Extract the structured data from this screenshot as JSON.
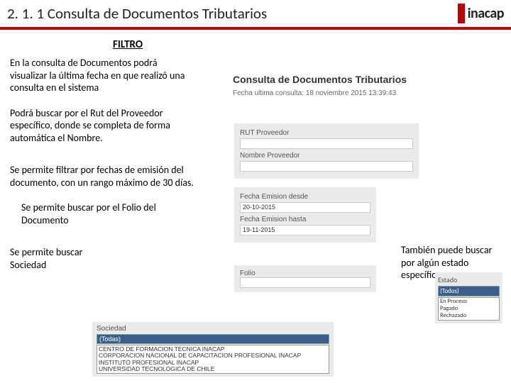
{
  "header": {
    "title": "2. 1. 1 Consulta de Documentos Tributarios",
    "logo": "inacap"
  },
  "filtro_heading": "FILTRO",
  "paras": {
    "p1": "En la consulta de Documentos podrá visualizar la última fecha en que realizó una consulta  en el sistema",
    "p2": "Podrá buscar por el Rut del Proveedor específico, donde se completa de forma automática el Nombre.",
    "p3": "Se permite filtrar por fechas de emisión del documento, con un rango máximo de 30 días.",
    "p4": "Se permite buscar por el Folio del Documento",
    "p5": "Se permite buscar Sociedad",
    "side": "También puede buscar por algún estado específico"
  },
  "sc1": {
    "title": "Consulta de Documentos Tributarios",
    "sub": "Fecha ultima consulta: 18 noviembre 2015 13:39:43"
  },
  "sc2": {
    "label1": "RUT Proveedor",
    "label2": "Nombre Proveedor"
  },
  "sc3": {
    "label1": "Fecha Emision desde",
    "val1": "20-10-2015",
    "label2": "Fecha Emision hasta",
    "val2": "19-11-2015"
  },
  "sc4": {
    "label": "Folio"
  },
  "sc5": {
    "label": "Sociedad",
    "selected": "(Todas)",
    "opts": [
      "CENTRO DE FORMACION TECNICA INACAP",
      "CORPORACION NACIONAL DE CAPACITACION PROFESIONAL INACAP",
      "INSTITUTO PROFESIONAL INACAP",
      "UNIVERSIDAD TECNOLOGICA DE CHILE"
    ]
  },
  "sc6": {
    "label": "Estado",
    "selected": "(Todos)",
    "opts": [
      "En Proceso",
      "Pagado",
      "Rechazado"
    ]
  }
}
